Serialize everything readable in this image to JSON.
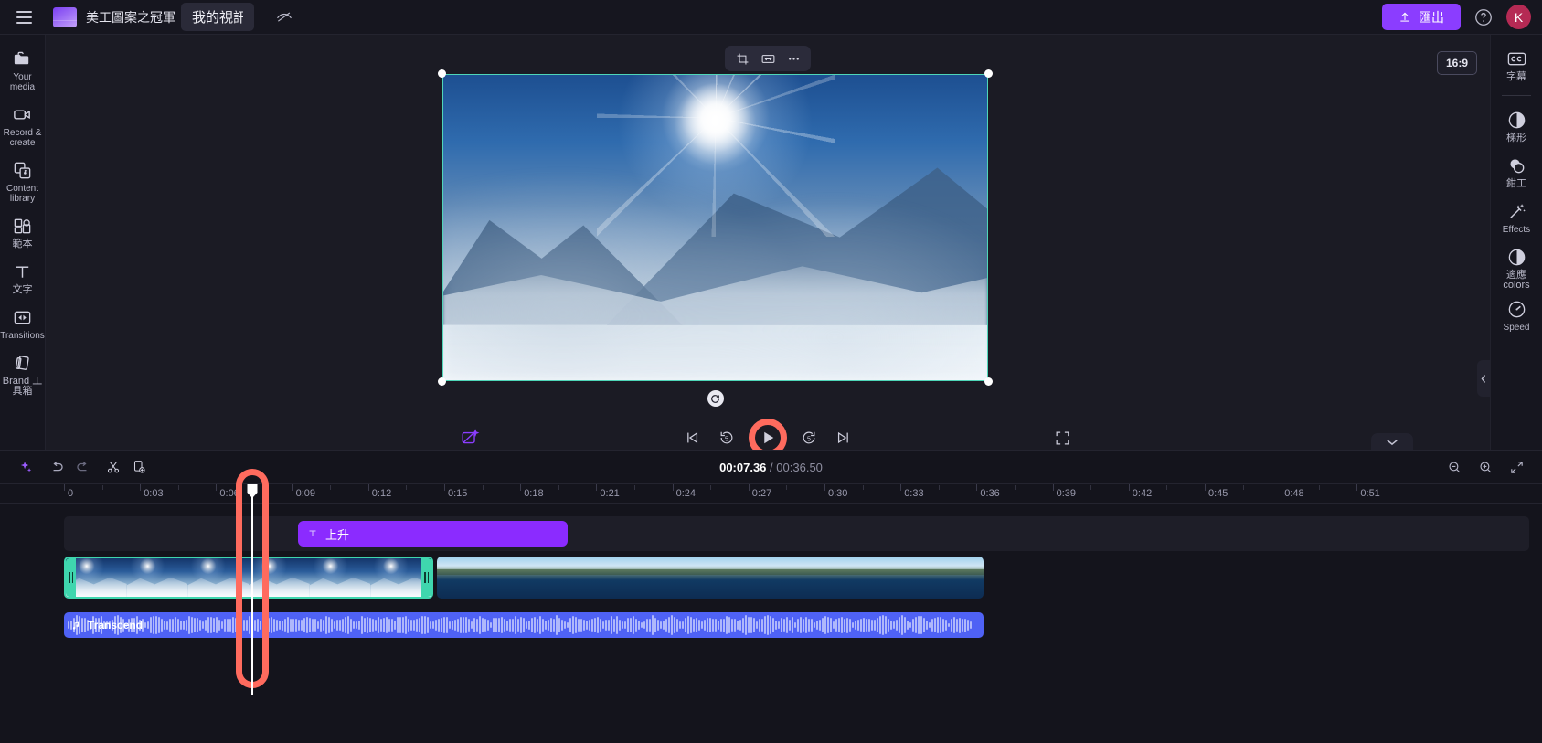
{
  "topbar": {
    "menu_icon": "hamburger-icon",
    "logo_icon": "clipchamp-logo",
    "project_label": "美工圖案之冠軍",
    "title_value": "我的視訊",
    "title_placeholder": "我的視訊",
    "visibility_icon": "eye-off-icon",
    "export_label": "匯出",
    "export_icon": "upload-icon",
    "help_icon": "help-circle-icon",
    "avatar_initial": "K",
    "accent": "#8b3dff",
    "avatar_color": "#b52a54"
  },
  "left_rail": {
    "items": [
      {
        "label": "Your media",
        "icon": "folder-icon"
      },
      {
        "label": "Record & create",
        "icon": "video-camera-icon"
      },
      {
        "label": "Content library",
        "icon": "library-icon"
      },
      {
        "label": "範本",
        "icon": "templates-icon"
      },
      {
        "label": "文字",
        "icon": "text-icon"
      },
      {
        "label": "Transitions",
        "icon": "transitions-icon"
      },
      {
        "label": "Brand 工具箱",
        "icon": "brand-kit-icon"
      }
    ],
    "expand_icon": "chevron-right-icon"
  },
  "right_rail": {
    "items": [
      {
        "label": "字幕",
        "icon": "closed-caption-icon"
      },
      {
        "label": "梯形",
        "icon": "fade-icon"
      },
      {
        "label": "鉗工",
        "icon": "filters-icon"
      },
      {
        "label": "Effects",
        "icon": "effects-wand-icon"
      },
      {
        "label": "適應 colors",
        "icon": "adjust-colors-icon"
      },
      {
        "label": "Speed",
        "icon": "speed-gauge-icon"
      }
    ]
  },
  "preview": {
    "float_tools": [
      {
        "name": "crop",
        "icon": "crop-icon"
      },
      {
        "name": "fit",
        "icon": "fit-icon"
      },
      {
        "name": "more",
        "icon": "more-horizontal-icon"
      }
    ],
    "aspect_ratio": "16:9",
    "rotate_icon": "rotate-handle-icon",
    "collapse_panel_icon": "chevron-left-icon",
    "collapse_timeline_icon": "chevron-down-icon"
  },
  "player": {
    "auto_compose_icon": "auto-compose-icon",
    "skip_back_icon": "skip-back-icon",
    "back5_icon": "rewind-5-icon",
    "play_icon": "play-icon",
    "forward5_icon": "forward-5-icon",
    "skip_forward_icon": "skip-forward-icon",
    "fullscreen_icon": "fullscreen-icon",
    "play_highlighted": true,
    "highlight_color": "#ff6b5e"
  },
  "timeline": {
    "toolbar": [
      {
        "name": "ai-suggestions",
        "icon": "sparkle-icon"
      },
      {
        "name": "undo",
        "icon": "undo-icon"
      },
      {
        "name": "redo",
        "icon": "redo-icon"
      },
      {
        "name": "split",
        "icon": "scissors-icon"
      },
      {
        "name": "duplicate",
        "icon": "duplicate-icon"
      }
    ],
    "current_time": "00:07.36",
    "separator": "/",
    "total_time": "00:36.50",
    "zoom_out_icon": "zoom-out-icon",
    "zoom_in_icon": "zoom-in-icon",
    "fit_icon": "fit-timeline-icon",
    "ruler_ticks": [
      "0",
      "0:03",
      "0:06",
      "0:09",
      "0:12",
      "0:15",
      "0:18",
      "0:21",
      "0:24",
      "0:27",
      "0:30",
      "0:33",
      "0:36",
      "0:39",
      "0:42",
      "0:45",
      "0:48",
      "0:51"
    ],
    "playhead_time": "00:07.36",
    "tracks": {
      "text_clip": {
        "label": "上升",
        "icon": "text-t-icon",
        "color": "#8b2bff"
      },
      "video_clip": {
        "name": "mountain-clip",
        "selected": true,
        "selection_color": "#3fd6ae"
      },
      "video_clip2": {
        "name": "lake-clip",
        "selected": false
      },
      "audio_clip": {
        "label": "Transcend",
        "icon": "music-note-icon",
        "color": "#4f62f5"
      }
    }
  }
}
